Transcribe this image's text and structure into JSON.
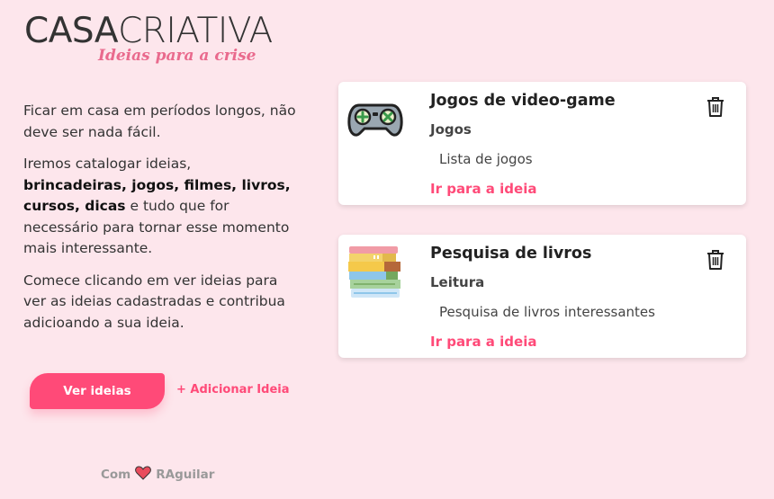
{
  "logo": {
    "bold": "CASA",
    "light": "CRIATIVA",
    "tagline": "Ideias para a crise"
  },
  "intro": {
    "p1": "Ficar em casa em períodos longos, não deve ser nada fácil.",
    "p2_start": "Iremos catalogar ideias,",
    "p2_bold": "brincadeiras, jogos, filmes, livros, cursos, dicas",
    "p2_end": "e tudo que for necessário para tornar esse momento mais interessante.",
    "p3": "Comece clicando em ver ideias para ver as ideias cadastradas e contribua adicioando a sua ideia."
  },
  "actions": {
    "view_label": "Ver ideias",
    "add_label": "+ Adicionar Ideia"
  },
  "footer": {
    "prefix": "Com",
    "author": "RAguilar"
  },
  "ideas": [
    {
      "title": "Jogos de video-game",
      "category": "Jogos",
      "description": "Lista de jogos",
      "link_label": "Ir para a ideia",
      "icon": "gamepad-icon"
    },
    {
      "title": "Pesquisa de livros",
      "category": "Leitura",
      "description": "Pesquisa de livros interessantes",
      "link_label": "Ir para a ideia",
      "icon": "books-icon"
    }
  ],
  "colors": {
    "background": "#fde6ec",
    "accent": "#ff4a78",
    "tagline": "#e96a8d"
  }
}
